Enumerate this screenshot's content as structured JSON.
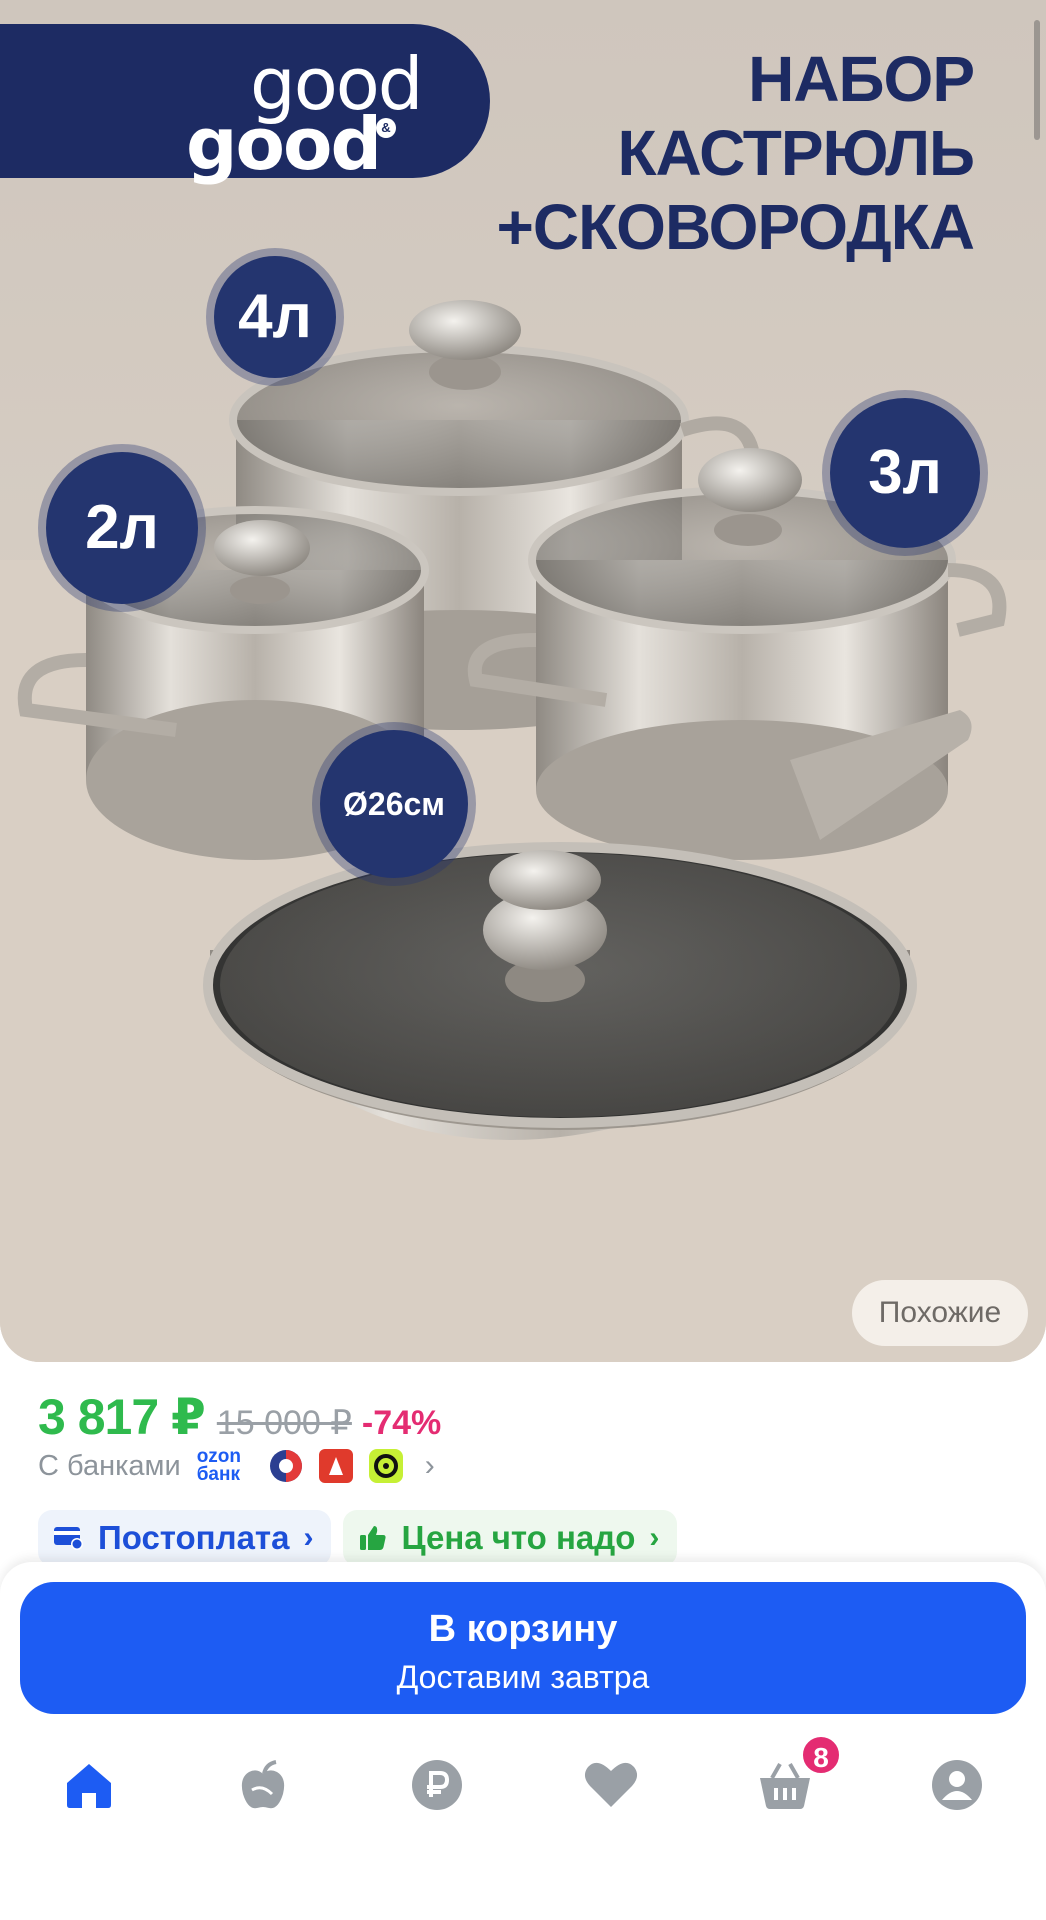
{
  "product_image": {
    "brand_line1": "good",
    "brand_line2": "good",
    "brand_amp": "&",
    "headline_line1": "НАБОР",
    "headline_line2": "КАСТРЮЛЬ",
    "headline_line3": "+СКОВОРОДКА",
    "badge_4": "4л",
    "badge_3": "3л",
    "badge_2": "2л",
    "badge_diameter": "Ø26см",
    "similar_label": "Похожие"
  },
  "price": {
    "current": "3 817 ₽",
    "old": "15 000 ₽",
    "discount": "-74%"
  },
  "banks": {
    "label": "С банками",
    "ozon_line1": "ozon",
    "ozon_line2": "банк",
    "chevron": "›"
  },
  "chips": {
    "postpay": "Постоплата",
    "good_price": "Цена что надо",
    "chevron": "›"
  },
  "cart_button": {
    "label": "В корзину",
    "sublabel": "Доставим завтра"
  },
  "tabbar": {
    "cart_count": "8",
    "active_color": "#1d5cf3",
    "inactive_color": "#9aa0a6",
    "icons": [
      "home-icon",
      "catalog-apple-icon",
      "ruble-icon",
      "heart-icon",
      "cart-icon",
      "profile-icon"
    ]
  }
}
